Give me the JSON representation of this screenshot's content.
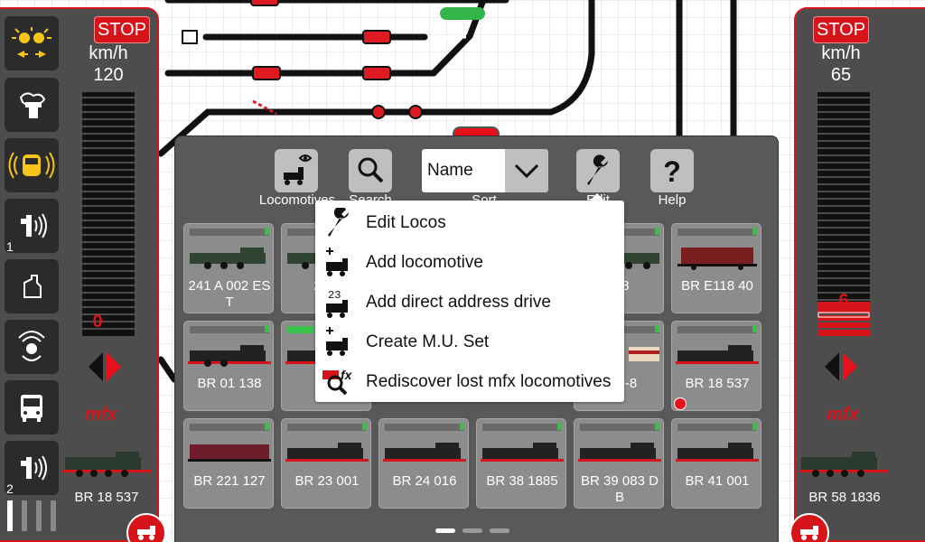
{
  "left_controller": {
    "stop_label": "STOP",
    "unit_label": "km/h",
    "max_speed": "120",
    "current_speed": "0",
    "loco_name": "BR 18 537",
    "fn_numbers": [
      "1",
      "2"
    ],
    "logo_text": "mfx"
  },
  "right_controller": {
    "stop_label": "STOP",
    "unit_label": "km/h",
    "max_speed": "65",
    "current_speed": "6",
    "loco_name": "BR 58 1836",
    "logo_text": "mfx"
  },
  "toolbar": {
    "locomotives_label": "Locomotives",
    "search_label": "Search",
    "sort_value": "Name",
    "sort_label": "Sort",
    "edit_label": "Edit",
    "help_label": "Help"
  },
  "menu": {
    "items": [
      {
        "label": "Edit Locos",
        "icon": "wrench-icon"
      },
      {
        "label": "Add locomotive",
        "icon": "add-loco-icon"
      },
      {
        "label": "Add direct address drive",
        "icon": "address-loco-icon"
      },
      {
        "label": "Create M.U. Set",
        "icon": "mu-set-icon"
      },
      {
        "label": "Rediscover lost mfx locomotives",
        "icon": "mfx-search-icon"
      }
    ]
  },
  "locos": {
    "row1": [
      "241 A 002 ES T",
      "241-",
      "",
      "",
      "6/8",
      "BR  E118 40"
    ],
    "row2": [
      "BR 01 138",
      "BR",
      "",
      "",
      "310-8",
      "BR 18 537"
    ],
    "row3": [
      "BR 221 127",
      "BR 23 001",
      "BR 24 016",
      "BR 38 1885",
      "BR 39 083 D B",
      "BR 41 001"
    ]
  },
  "colors": {
    "accent_red": "#d7141a",
    "panel_grey": "#4d4d4d",
    "status_green": "#39c24a"
  }
}
